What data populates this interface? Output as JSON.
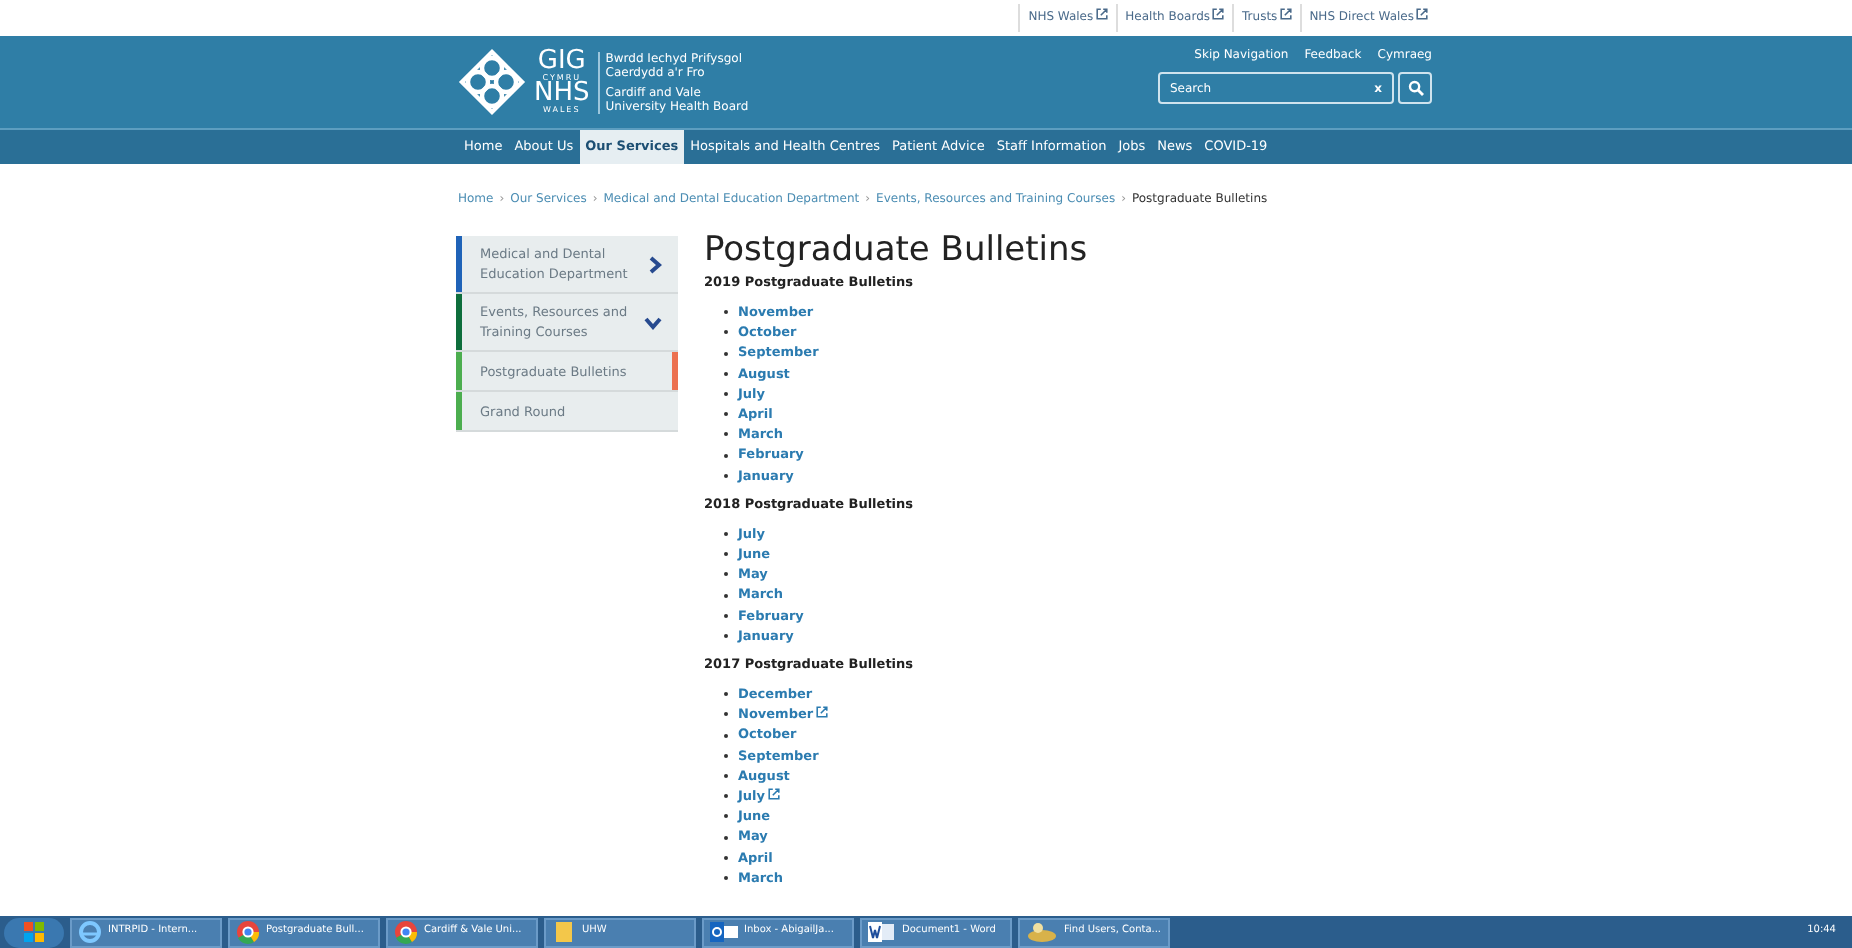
{
  "top_links": [
    {
      "label": "NHS Wales",
      "external": true
    },
    {
      "label": "Health Boards",
      "external": true
    },
    {
      "label": "Trusts",
      "external": true
    },
    {
      "label": "NHS Direct Wales",
      "external": true
    }
  ],
  "logo": {
    "mark_top": "GIG",
    "mark_sub_top": "CYMRU",
    "mark_mid": "NHS",
    "mark_sub_bottom": "WALES",
    "welsh_name": [
      "Bwrdd Iechyd Prifysgol",
      "Caerdydd a'r Fro"
    ],
    "english_name": [
      "Cardiff and Vale",
      "University Health Board"
    ]
  },
  "header_links": [
    "Skip Navigation",
    "Feedback",
    "Cymraeg"
  ],
  "search": {
    "placeholder": "Search",
    "clear": "x"
  },
  "nav": [
    {
      "label": "Home",
      "selected": false
    },
    {
      "label": "About Us",
      "selected": false
    },
    {
      "label": "Our Services",
      "selected": true
    },
    {
      "label": "Hospitals and Health Centres",
      "selected": false
    },
    {
      "label": "Patient Advice",
      "selected": false
    },
    {
      "label": "Staff Information",
      "selected": false
    },
    {
      "label": "Jobs",
      "selected": false
    },
    {
      "label": "News",
      "selected": false
    },
    {
      "label": "COVID-19",
      "selected": false
    }
  ],
  "breadcrumb_separator": "›",
  "breadcrumb": [
    "Home",
    "Our Services",
    "Medical and Dental Education Department",
    "Events, Resources and Training Courses",
    "Postgraduate Bulletins"
  ],
  "sidebar": [
    {
      "label": "Medical and Dental Education Department",
      "color": "#1f63b8",
      "kind": "expandable",
      "expanded": false,
      "selected": false
    },
    {
      "label": "Events, Resources and Training Courses",
      "color": "#0e6e3c",
      "kind": "expandable",
      "expanded": true,
      "selected": false
    },
    {
      "label": "Postgraduate Bulletins",
      "color": "#4cae4f",
      "kind": "page",
      "selected": true
    },
    {
      "label": "Grand Round",
      "color": "#4cae4f",
      "kind": "page",
      "selected": false
    }
  ],
  "title": "Postgraduate Bulletins",
  "sections": [
    {
      "heading": "2019 Postgraduate Bulletins",
      "items": [
        {
          "label": "November",
          "external": false
        },
        {
          "label": "October",
          "external": false
        },
        {
          "label": "September",
          "external": false
        },
        {
          "label": "August",
          "external": false
        },
        {
          "label": "July",
          "external": false
        },
        {
          "label": "April",
          "external": false
        },
        {
          "label": "March",
          "external": false
        },
        {
          "label": "February",
          "external": false
        },
        {
          "label": "January",
          "external": false
        }
      ]
    },
    {
      "heading": "2018 Postgraduate Bulletins",
      "items": [
        {
          "label": "July",
          "external": false
        },
        {
          "label": "June",
          "external": false
        },
        {
          "label": "May",
          "external": false
        },
        {
          "label": "March",
          "external": false
        },
        {
          "label": "February",
          "external": false
        },
        {
          "label": "January",
          "external": false
        }
      ]
    },
    {
      "heading": "2017 Postgraduate Bulletins",
      "items": [
        {
          "label": "December",
          "external": false
        },
        {
          "label": "November",
          "external": true
        },
        {
          "label": "October",
          "external": false
        },
        {
          "label": "September",
          "external": false
        },
        {
          "label": "August",
          "external": false
        },
        {
          "label": "July",
          "external": true
        },
        {
          "label": "June",
          "external": false
        },
        {
          "label": "May",
          "external": false
        },
        {
          "label": "April",
          "external": false
        },
        {
          "label": "March",
          "external": false
        }
      ]
    }
  ],
  "taskbar": [
    {
      "kind": "ie",
      "label": "INTRPID - Intern..."
    },
    {
      "kind": "chrome",
      "label": "Postgraduate Bull..."
    },
    {
      "kind": "chrome",
      "label": "Cardiff & Vale Uni..."
    },
    {
      "kind": "folder",
      "label": "UHW"
    },
    {
      "kind": "outlook",
      "label": "Inbox - AbigailJa..."
    },
    {
      "kind": "word",
      "label": "Document1 - Word"
    },
    {
      "kind": "app",
      "label": "Find Users, Conta..."
    }
  ],
  "clock": "10:44"
}
